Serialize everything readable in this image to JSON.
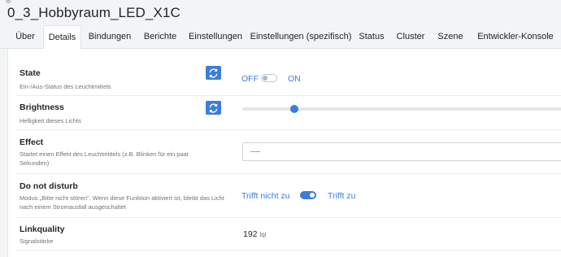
{
  "window": {
    "corner_mark": "®"
  },
  "device": {
    "title": "0_3_Hobbyraum_LED_X1C"
  },
  "tabs": [
    {
      "label": "Über"
    },
    {
      "label": "Details",
      "active": true
    },
    {
      "label": "Bindungen"
    },
    {
      "label": "Berichte"
    },
    {
      "label": "Einstellungen"
    },
    {
      "label": "Einstellungen (spezifisch)"
    },
    {
      "label": "Status"
    },
    {
      "label": "Cluster"
    },
    {
      "label": "Szene"
    },
    {
      "label": "Entwickler-Konsole"
    }
  ],
  "rows": {
    "state": {
      "label": "State",
      "desc": "Ein-/Aus-Status des Leuchtmittels",
      "off_label": "OFF",
      "on_label": "ON",
      "value": false,
      "refresh_icon": "refresh-icon"
    },
    "brightness": {
      "label": "Brightness",
      "desc": "Helligkeit dieses Lichts",
      "slider_fraction": 0.16,
      "refresh_icon": "refresh-icon"
    },
    "effect": {
      "label": "Effect",
      "desc": "Startet einen Effekt des Leuchtmittels (z.B. Blinken für ein paar Sekunden)",
      "select_value": "----"
    },
    "do_not_disturb": {
      "label": "Do not disturb",
      "desc": "Modus „Bitte nicht stören\". Wenn diese Funktion aktiviert ist, bleibt das Licht nach einem Stromausfall ausgeschaltet",
      "off_label": "Trifft nicht zu",
      "on_label": "Trifft zu",
      "value": true
    },
    "linkquality": {
      "label": "Linkquality",
      "desc": "Signalstärke",
      "value": "192",
      "unit": "lqi"
    }
  },
  "colors": {
    "accent": "#3b7ddd",
    "background": "#f3f4f6",
    "panel": "#ffffff"
  }
}
